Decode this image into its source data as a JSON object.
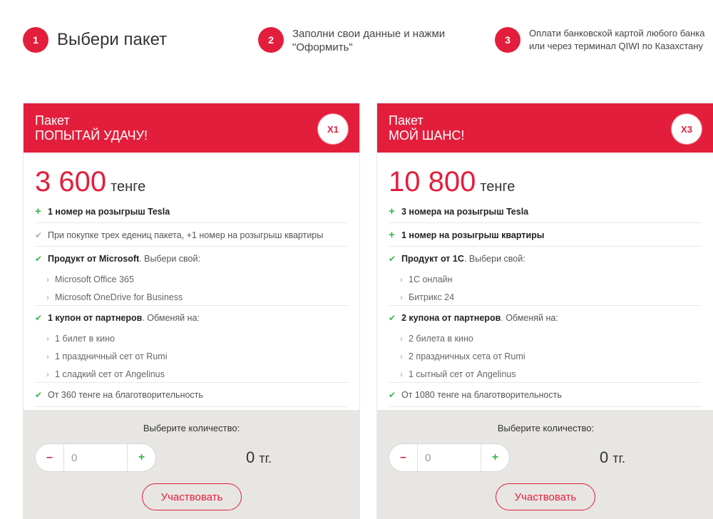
{
  "steps": [
    {
      "num": "1",
      "text": "Выбери пакет"
    },
    {
      "num": "2",
      "text_line1": "Заполни свои данные и нажми",
      "text_line2": "\"Оформить\""
    },
    {
      "num": "3",
      "text_line1": "Оплати банковской картой любого банка",
      "text_line2": "или через терминал QIWI по Казахстану"
    }
  ],
  "packages": [
    {
      "label": "Пакет",
      "name": "ПОПЫТАЙ УДАЧУ!",
      "badge": "X1",
      "price": "3 600",
      "currency": "тенге",
      "f1": "1 номер на розыгрыш Tesla",
      "f2": "При покупке трех едениц пакета, +1 номер на розыгрыш квартиры",
      "f3_bold": "Продукт от Microsoft",
      "f3_rest": ". Выбери свой:",
      "f3_subs": [
        "Microsoft Office 365",
        "Microsoft OneDrive for Business"
      ],
      "f4_bold": "1 купон от партнеров",
      "f4_rest": ". Обменяй на:",
      "f4_subs": [
        "1 билет в кино",
        "1 праздничный сет от Rumi",
        "1 сладкий сет от Angelinus"
      ],
      "f5": "От 360 тенге на благотворительность",
      "qty_label": "Выберите количество:",
      "qty_value": "0",
      "minus": "–",
      "plus": "+",
      "total_num": "0",
      "total_unit": "тг.",
      "button": "Участвовать"
    },
    {
      "label": "Пакет",
      "name": "МОЙ ШАНС!",
      "badge": "X3",
      "price": "10 800",
      "currency": "тенге",
      "f1": "3 номера на розыгрыш Tesla",
      "f2": "1 номер на розыгрыш квартиры",
      "f3_bold": "Продукт от 1С",
      "f3_rest": ". Выбери свой:",
      "f3_subs": [
        "1С онлайн",
        "Битрикс 24"
      ],
      "f4_bold": "2 купона от партнеров",
      "f4_rest": ". Обменяй на:",
      "f4_subs": [
        "2 билета в кино",
        "2 праздничных сета от Rumi",
        "1 сытный сет от Angelinus"
      ],
      "f5": "От 1080 тенге на благотворительность",
      "qty_label": "Выберите количество:",
      "qty_value": "0",
      "minus": "–",
      "plus": "+",
      "total_num": "0",
      "total_unit": "тг.",
      "button": "Участвовать"
    }
  ],
  "icons": {
    "plus": "plus-icon",
    "check": "check-icon",
    "chevron": "chevron-right-icon"
  },
  "colors": {
    "accent": "#e31e3c",
    "green": "#3ab54a",
    "panel": "#e8e6e3"
  }
}
